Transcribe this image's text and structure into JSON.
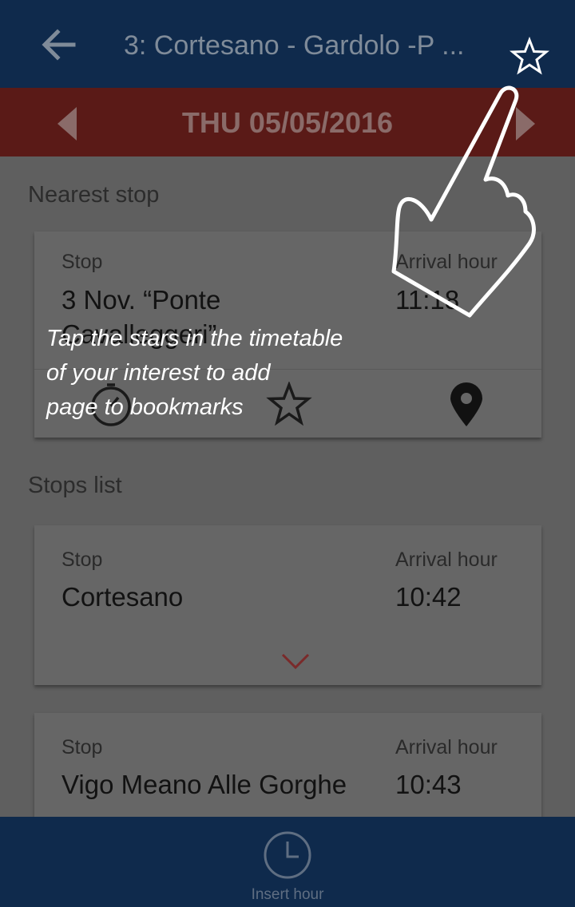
{
  "header": {
    "title": "3: Cortesano - Gardolo -P ...",
    "icons": {
      "back": "arrow-left-icon",
      "bookmark": "star-outline-icon"
    }
  },
  "date_bar": {
    "date": "THU 05/05/2016",
    "icons": {
      "prev": "caret-left-icon",
      "next": "caret-right-icon"
    }
  },
  "nearest": {
    "section_title": "Nearest stop",
    "stop_label": "Stop",
    "stop_name_line1": "3 Nov. “Ponte",
    "stop_name_line2": "Cavalleggeri”",
    "arrival_label": "Arrival hour",
    "arrival_time": "11:18",
    "actions": [
      "timer-icon",
      "star-outline-icon",
      "map-pin-icon"
    ]
  },
  "overlay": {
    "line1": "Tap the stars in the timetable",
    "line2": "of your interest to add",
    "line3": "page to bookmarks",
    "hand_icon": "tap-hand-icon"
  },
  "stops_list": {
    "section_title": "Stops list",
    "items": [
      {
        "stop_label": "Stop",
        "name": "Cortesano",
        "arrival_label": "Arrival hour",
        "time": "10:42",
        "expand_icon": "chevron-down-icon"
      },
      {
        "stop_label": "Stop",
        "name": "Vigo Meano Alle Gorghe",
        "arrival_label": "Arrival hour",
        "time": "10:43"
      }
    ]
  },
  "bottom": {
    "label": "Insert hour",
    "icon": "clock-icon"
  },
  "colors": {
    "header_bg": "#0f2a4c",
    "date_bar_bg": "#5a1a17",
    "overlay_text": "#ffffff",
    "chevron": "#7a2a2a"
  }
}
